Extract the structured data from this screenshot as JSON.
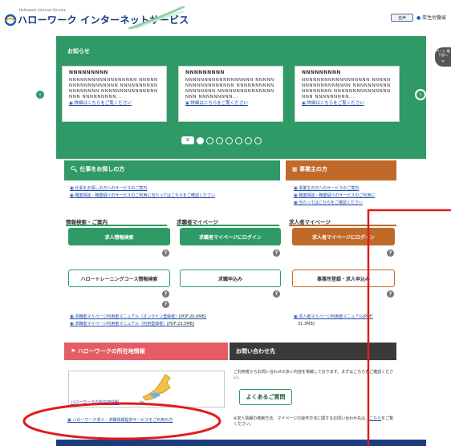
{
  "header": {
    "logo_small": "Hellowork Internet Service",
    "logo_main": "ハローワーク インターネットサービス",
    "lang_button": "音声",
    "ministry": "厚生労働省"
  },
  "news": {
    "title": "お知らせ",
    "cards": [
      {
        "title": "NNNNNNNNN",
        "body": "NNNNNNNNNNNNNNNNNN NNNNNNNNNNNNNNNNNN NNNNNNNNNNNNNNNNNN NNNNNNNNNNNNNNNNNN NNNNNNNNN...",
        "link": "詳細はこちらをご覧ください"
      },
      {
        "title": "NNNNNNNNN",
        "body": "NNNNNNNNNNNNNNNNNN NNNNNNNNNNNNNNNNNN NNNNNNNNNNNNNNNNNN NNNNNNNNNNNNNNNNNN NNNNNNNNN...",
        "link": "詳細はこちらをご覧ください"
      },
      {
        "title": "NNNNNNNNN",
        "body": "NNNNNNNNNNNNNNNNNN NNNNNNNNNNNNNNNNNN NNNNNNNNNNNNNNNNNN NNNNNNNNNNNNNNNNNN NNNNNNNNN...",
        "link": "詳細はこちらをご覧ください"
      }
    ],
    "pause_label": "II",
    "page_count": 7,
    "active_page": 1,
    "prev_icon": "‹",
    "next_icon": "›"
  },
  "side_tab": "ページ 最下部へ",
  "job_seekers": {
    "title": "仕事をお探しの方",
    "links": [
      "仕事をお探しの方へのサービスのご案内",
      "職業相談・職業紹介のサービスのご利用に当たってはこちらをご確認ください"
    ]
  },
  "employers": {
    "title": "事業主の方",
    "links": [
      "事業主の方へのサービスのご案内",
      "職業相談・職業紹介のサービスのご利用に",
      "当たってはこちらをご確認ください"
    ]
  },
  "sections": {
    "info": "情報検索・ご案内",
    "seeker_mypage": "求職者マイページ",
    "employer_mypage": "求人者マイページ"
  },
  "buttons": {
    "job_search": "求人情報検索",
    "seeker_login": "求職者マイページにログイン",
    "employer_login": "求人者マイページにログイン",
    "training_search": "ハロートレーニングコース情報検索",
    "seeker_apply": "求職申込み",
    "employer_register": "事業所登録・求人申込み"
  },
  "manuals": {
    "seeker_online": "求職者マイページ利用者マニュアル（オンライン登録者）",
    "seeker_online_size": "[PDF:20.6MB]",
    "seeker_office": "求職者マイページ利用者マニュアル（利用登録者）",
    "seeker_office_size": "[PDF:23.5MB]",
    "employer": "求人者マイページ利用者マニュアル",
    "employer_size": "[PDF:",
    "employer_size2": "31.3MB]"
  },
  "location": {
    "title": "ハローワークの所在地情報",
    "map_link": "ハローワークの所在地情報",
    "service_link": "ハローワーク求人・求職情報提供サービスをご利用の方"
  },
  "contact": {
    "title": "お問い合わせ先",
    "desc": "ご利用者からお問い合わせの多い内容を掲載しております。まずはこちらをご確認ください。",
    "faq": "よくあるご質問",
    "note": "※求人情報の検索方法、マイページの操作方法に関するお問い合わせ先は、",
    "note_link": "こちら",
    "note_end": "をご覧ください。"
  },
  "colors": {
    "green": "#2f9a66",
    "orange": "#c06a2a",
    "pink": "#e45c64",
    "dark": "#3a3a3a",
    "navy": "#1d3c80",
    "annotation_red": "#e31b1b"
  }
}
